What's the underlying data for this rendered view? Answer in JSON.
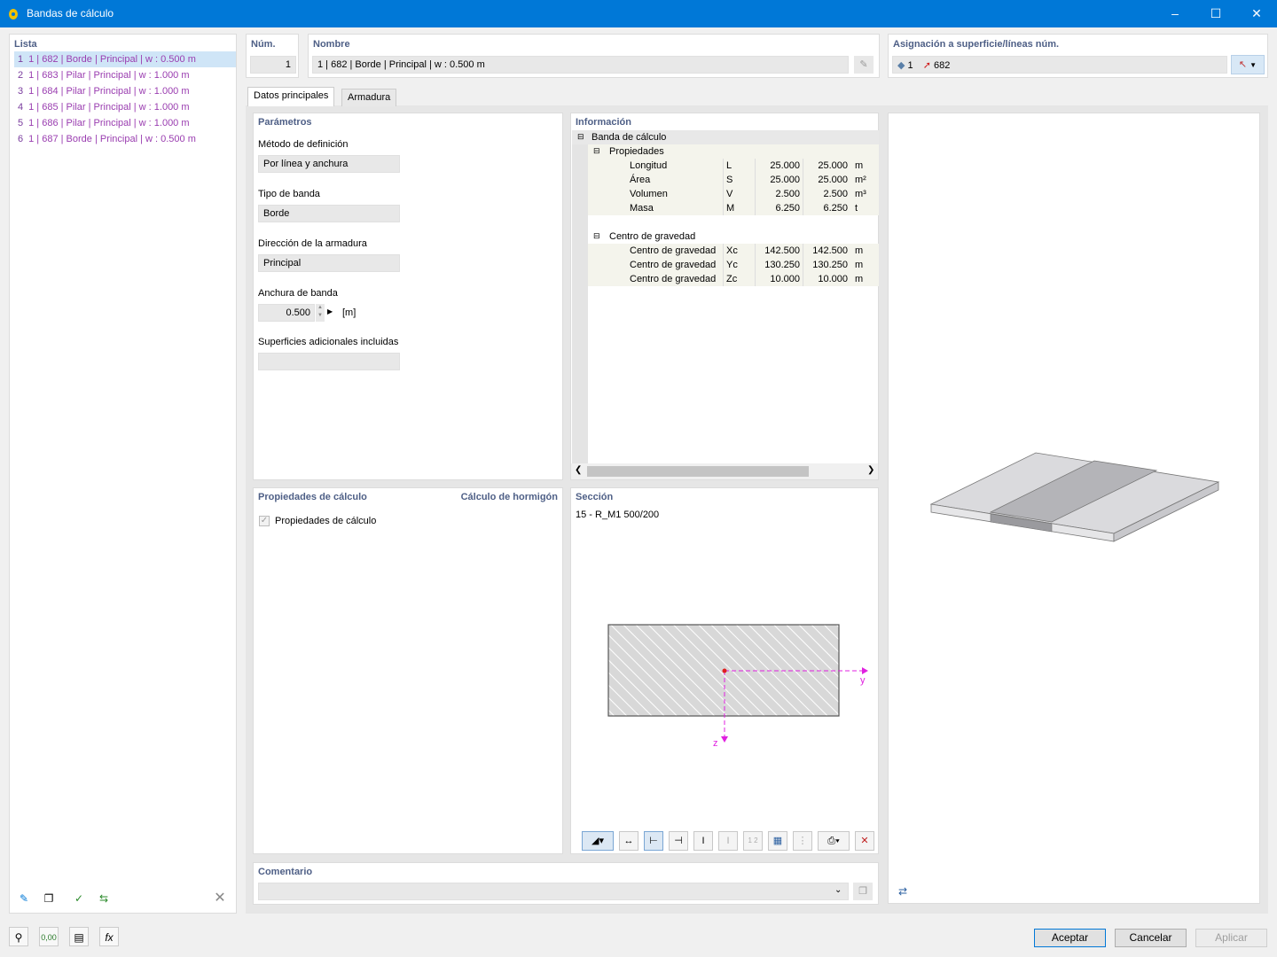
{
  "window": {
    "title": "Bandas de cálculo"
  },
  "list": {
    "header": "Lista",
    "items": [
      {
        "num": "1",
        "label": "1 | 682 | Borde | Principal | w : 0.500 m"
      },
      {
        "num": "2",
        "label": "1 | 683 | Pilar | Principal | w : 1.000 m"
      },
      {
        "num": "3",
        "label": "1 | 684 | Pilar | Principal | w : 1.000 m"
      },
      {
        "num": "4",
        "label": "1 | 685 | Pilar | Principal | w : 1.000 m"
      },
      {
        "num": "5",
        "label": "1 | 686 | Pilar | Principal | w : 1.000 m"
      },
      {
        "num": "6",
        "label": "1 | 687 | Borde | Principal | w : 0.500 m"
      }
    ]
  },
  "num": {
    "header": "Núm.",
    "value": "1"
  },
  "nombre": {
    "header": "Nombre",
    "value": "1 | 682 | Borde | Principal | w : 0.500 m"
  },
  "asignacion": {
    "header": "Asignación a superficie/líneas núm.",
    "surface": "1",
    "line": "682"
  },
  "tabs": [
    "Datos principales",
    "Armadura"
  ],
  "parametros": {
    "header": "Parámetros",
    "metodo_label": "Método de definición",
    "metodo_value": "Por línea y anchura",
    "tipo_label": "Tipo de banda",
    "tipo_value": "Borde",
    "direccion_label": "Dirección de la armadura",
    "direccion_value": "Principal",
    "anchura_label": "Anchura de banda",
    "anchura_value": "0.500",
    "anchura_unit": "[m]",
    "superficies_label": "Superficies adicionales incluidas",
    "superficies_value": ""
  },
  "informacion": {
    "header": "Información",
    "root": "Banda de cálculo",
    "propiedades": "Propiedades",
    "rows": [
      {
        "name": "Longitud",
        "sym": "L",
        "v1": "25.000",
        "v2": "25.000",
        "unit": "m"
      },
      {
        "name": "Área",
        "sym": "S",
        "v1": "25.000",
        "v2": "25.000",
        "unit": "m²"
      },
      {
        "name": "Volumen",
        "sym": "V",
        "v1": "2.500",
        "v2": "2.500",
        "unit": "m³"
      },
      {
        "name": "Masa",
        "sym": "M",
        "v1": "6.250",
        "v2": "6.250",
        "unit": "t"
      }
    ],
    "centro": "Centro de gravedad",
    "centro_rows": [
      {
        "name": "Centro de gravedad",
        "sym": "Xc",
        "v1": "142.500",
        "v2": "142.500",
        "unit": "m"
      },
      {
        "name": "Centro de gravedad",
        "sym": "Yc",
        "v1": "130.250",
        "v2": "130.250",
        "unit": "m"
      },
      {
        "name": "Centro de gravedad",
        "sym": "Zc",
        "v1": "10.000",
        "v2": "10.000",
        "unit": "m"
      }
    ]
  },
  "propiedades_calculo": {
    "header": "Propiedades de cálculo",
    "addon": "Cálculo de hormigón",
    "checkbox_label": "Propiedades de cálculo",
    "checked": true
  },
  "seccion": {
    "header": "Sección",
    "name": "15 - R_M1 500/200",
    "axis_y": "y",
    "axis_z": "z"
  },
  "comentario": {
    "header": "Comentario",
    "value": ""
  },
  "buttons": {
    "accept": "Aceptar",
    "cancel": "Cancelar",
    "apply": "Aplicar"
  },
  "colors": {
    "accent": "#0078d7",
    "header_text": "#4e5f86",
    "list_text": "#9a3db0",
    "axis": "#e020e0"
  }
}
